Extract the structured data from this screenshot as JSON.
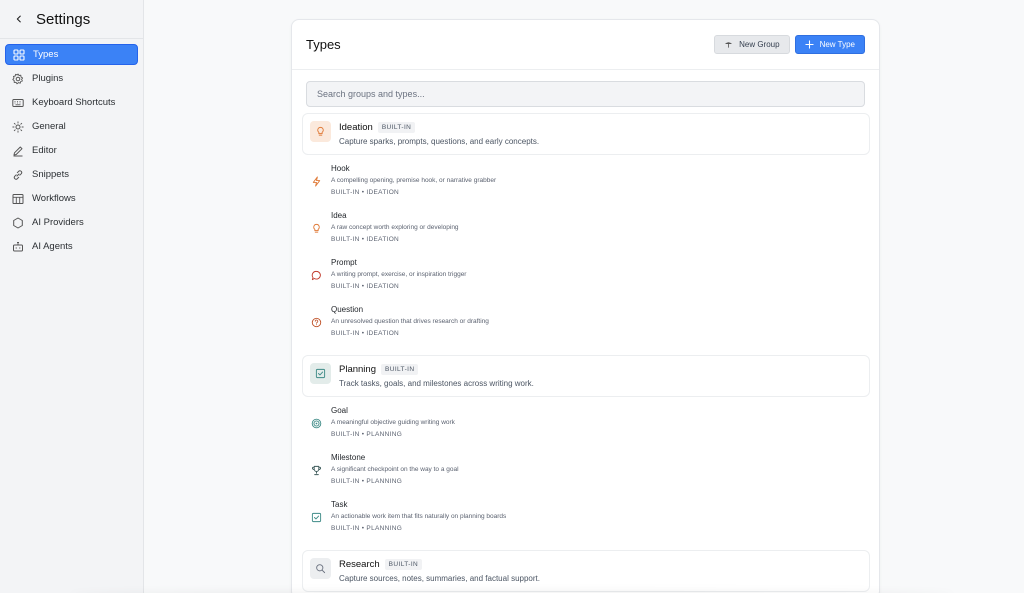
{
  "colors": {
    "accent": "#3b82f6",
    "ideation": "#e07b39",
    "planning": "#3d8a86",
    "research": "#6b7280"
  },
  "sidebar": {
    "title": "Settings",
    "items": [
      {
        "label": "Types",
        "icon": "grid-icon"
      },
      {
        "label": "Plugins",
        "icon": "gear-icon"
      },
      {
        "label": "Keyboard Shortcuts",
        "icon": "keyboard-icon"
      },
      {
        "label": "General",
        "icon": "sun-icon"
      },
      {
        "label": "Editor",
        "icon": "pencil-icon"
      },
      {
        "label": "Snippets",
        "icon": "link-icon"
      },
      {
        "label": "Workflows",
        "icon": "table-icon"
      },
      {
        "label": "AI Providers",
        "icon": "hexagon-icon"
      },
      {
        "label": "AI Agents",
        "icon": "robot-icon"
      }
    ]
  },
  "main": {
    "title": "Types",
    "new_group_label": "New Group",
    "new_type_label": "New Type",
    "search_placeholder": "Search groups and types...",
    "groups": [
      {
        "name": "Ideation",
        "badge": "BUILT-IN",
        "description": "Capture sparks, prompts, questions, and early concepts.",
        "icon": "lightbulb-icon",
        "types": [
          {
            "name": "Hook",
            "description": "A compelling opening, premise hook, or narrative grabber",
            "meta": "BUILT-IN • IDEATION",
            "icon": "lightning-icon"
          },
          {
            "name": "Idea",
            "description": "A raw concept worth exploring or developing",
            "meta": "BUILT-IN • IDEATION",
            "icon": "lightbulb-icon"
          },
          {
            "name": "Prompt",
            "description": "A writing prompt, exercise, or inspiration trigger",
            "meta": "BUILT-IN • IDEATION",
            "icon": "chat-bubble-icon"
          },
          {
            "name": "Question",
            "description": "An unresolved question that drives research or drafting",
            "meta": "BUILT-IN • IDEATION",
            "icon": "question-icon"
          }
        ]
      },
      {
        "name": "Planning",
        "badge": "BUILT-IN",
        "description": "Track tasks, goals, and milestones across writing work.",
        "icon": "checkbox-icon",
        "types": [
          {
            "name": "Goal",
            "description": "A meaningful objective guiding writing work",
            "meta": "BUILT-IN • PLANNING",
            "icon": "target-icon"
          },
          {
            "name": "Milestone",
            "description": "A significant checkpoint on the way to a goal",
            "meta": "BUILT-IN • PLANNING",
            "icon": "trophy-icon"
          },
          {
            "name": "Task",
            "description": "An actionable work item that fits naturally on planning boards",
            "meta": "BUILT-IN • PLANNING",
            "icon": "checkbox-icon"
          }
        ]
      },
      {
        "name": "Research",
        "badge": "BUILT-IN",
        "description": "Capture sources, notes, summaries, and factual support.",
        "icon": "search-icon",
        "types": []
      }
    ]
  }
}
